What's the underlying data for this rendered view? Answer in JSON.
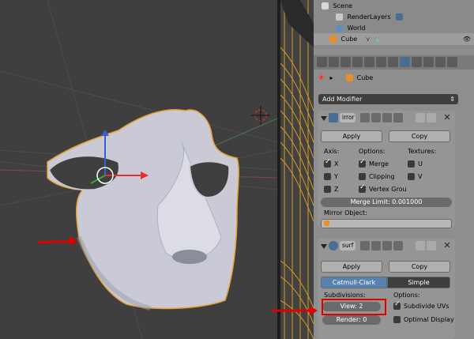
{
  "outliner": {
    "scene": "Scene",
    "renderlayers": "RenderLayers",
    "world": "World",
    "cube": "Cube"
  },
  "properties": {
    "breadcrumb": "Cube",
    "add_modifier": "Add Modifier"
  },
  "mirror": {
    "name": "irror",
    "apply": "Apply",
    "copy": "Copy",
    "axis_label": "Axis:",
    "options_label": "Options:",
    "textures_label": "Textures:",
    "x": "X",
    "y": "Y",
    "z": "Z",
    "merge": "Merge",
    "clipping": "Clipping",
    "vertex_groups": "Vertex Grou",
    "u": "U",
    "v": "V",
    "merge_limit": "Merge Limit: 0.001000",
    "mirror_object": "Mirror Object:"
  },
  "subsurf": {
    "name": "surf",
    "apply": "Apply",
    "copy": "Copy",
    "catmull": "Catmull-Clark",
    "simple": "Simple",
    "subdivisions_label": "Subdivisions:",
    "options_label": "Options:",
    "view": "View: 2",
    "render": "Render: 0",
    "subdivide_uvs": "Subdivide UVs",
    "optimal_display": "Optimal Display"
  },
  "colors": {
    "annotation_red": "#e00000",
    "accent_blue": "#5580b0",
    "selection_orange": "#f0a020"
  }
}
